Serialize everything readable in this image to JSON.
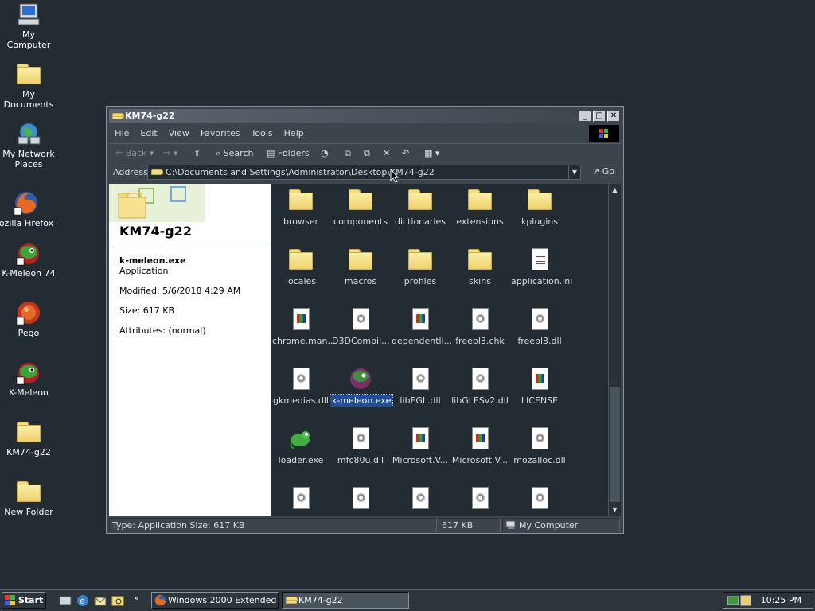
{
  "desktop": {
    "icons": [
      {
        "label": "My Computer",
        "icon": "my-computer-icon"
      },
      {
        "label": "My Documents",
        "icon": "my-documents-icon"
      },
      {
        "label": "My Network Places",
        "icon": "my-network-places-icon"
      },
      {
        "label": "ozilla Firefox",
        "icon": "firefox-icon"
      },
      {
        "label": "K-Meleon 74",
        "icon": "k-meleon-icon"
      },
      {
        "label": "Pego",
        "icon": "pego-icon"
      },
      {
        "label": "K-Meleon",
        "icon": "k-meleon-icon"
      },
      {
        "label": "KM74-g22",
        "icon": "folder-icon"
      },
      {
        "label": "New Folder",
        "icon": "folder-icon"
      }
    ]
  },
  "window": {
    "title": "KM74-g22",
    "controls": {
      "minimize": "_",
      "maximize": "□",
      "close": "✕"
    },
    "menu": [
      "File",
      "Edit",
      "View",
      "Favorites",
      "Tools",
      "Help"
    ],
    "toolbar": {
      "back": "Back",
      "search": "Search",
      "folders": "Folders"
    },
    "address": {
      "label": "Address",
      "value": "C:\\Documents and Settings\\Administrator\\Desktop\\KM74-g22",
      "go": "Go"
    },
    "left_pane": {
      "folder_name": "KM74-g22",
      "file_name": "k-meleon.exe",
      "file_type": "Application",
      "modified": "Modified: 5/6/2018 4:29 AM",
      "size": "Size: 617 KB",
      "attributes": "Attributes: (normal)"
    },
    "files": [
      {
        "label": "browser",
        "type": "folder"
      },
      {
        "label": "components",
        "type": "folder"
      },
      {
        "label": "dictionaries",
        "type": "folder"
      },
      {
        "label": "extensions",
        "type": "folder"
      },
      {
        "label": "kplugins",
        "type": "folder"
      },
      {
        "label": "locales",
        "type": "folder"
      },
      {
        "label": "macros",
        "type": "folder"
      },
      {
        "label": "profiles",
        "type": "folder"
      },
      {
        "label": "skins",
        "type": "folder"
      },
      {
        "label": "application.ini",
        "type": "txt"
      },
      {
        "label": "chrome.man...",
        "type": "app"
      },
      {
        "label": "D3DCompil...",
        "type": "dll"
      },
      {
        "label": "dependentli...",
        "type": "app"
      },
      {
        "label": "freebl3.chk",
        "type": "dll"
      },
      {
        "label": "freebl3.dll",
        "type": "dll"
      },
      {
        "label": "gkmedias.dll",
        "type": "dll"
      },
      {
        "label": "k-meleon.exe",
        "type": "exe",
        "selected": true
      },
      {
        "label": "libEGL.dll",
        "type": "dll"
      },
      {
        "label": "libGLESv2.dll",
        "type": "dll"
      },
      {
        "label": "LICENSE",
        "type": "app"
      },
      {
        "label": "loader.exe",
        "type": "loader"
      },
      {
        "label": "mfc80u.dll",
        "type": "dll"
      },
      {
        "label": "Microsoft.V...",
        "type": "app"
      },
      {
        "label": "Microsoft.V...",
        "type": "app"
      },
      {
        "label": "mozalloc.dll",
        "type": "dll"
      },
      {
        "label": "",
        "type": "dll"
      },
      {
        "label": "",
        "type": "dll"
      },
      {
        "label": "",
        "type": "dll"
      },
      {
        "label": "",
        "type": "dll"
      },
      {
        "label": "",
        "type": "dll"
      }
    ],
    "status": {
      "info": "Type: Application Size: 617 KB",
      "size": "617 KB",
      "zone": "My Computer"
    }
  },
  "taskbar": {
    "start": "Start",
    "quicklaunch_more": "»",
    "tasks": [
      {
        "label": "Windows 2000 Extended ...",
        "icon": "firefox-icon",
        "active": false
      },
      {
        "label": "KM74-g22",
        "icon": "folder-icon",
        "active": true
      }
    ],
    "clock": "10:25 PM"
  }
}
